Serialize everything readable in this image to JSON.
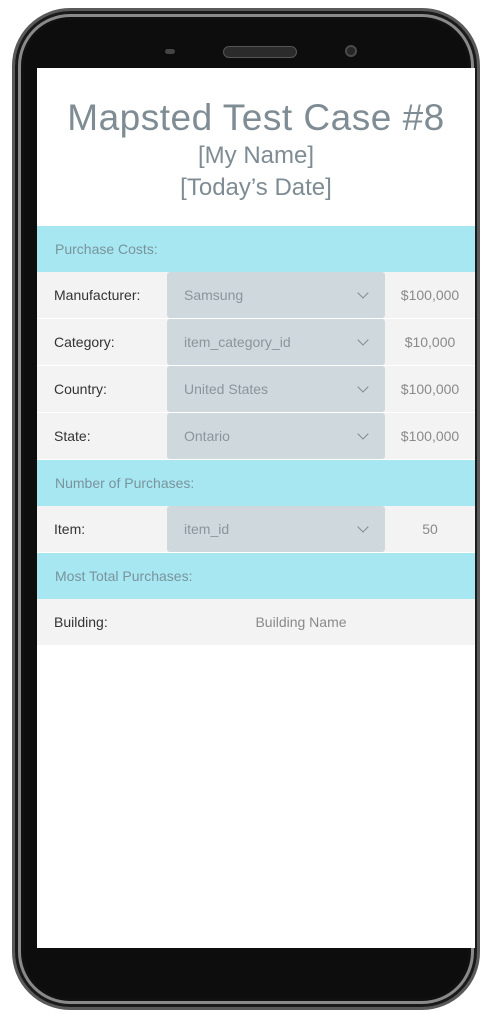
{
  "header": {
    "title": "Mapsted Test Case #8",
    "name": "[My Name]",
    "date": "[Today’s Date]"
  },
  "purchase_costs": {
    "heading": "Purchase Costs:",
    "rows": [
      {
        "label": "Manufacturer:",
        "selected": "Samsung",
        "value": "$100,000"
      },
      {
        "label": "Category:",
        "selected": "item_category_id",
        "value": "$10,000"
      },
      {
        "label": "Country:",
        "selected": "United States",
        "value": "$100,000"
      },
      {
        "label": "State:",
        "selected": "Ontario",
        "value": "$100,000"
      }
    ]
  },
  "number_of_purchases": {
    "heading": "Number of Purchases:",
    "row": {
      "label": "Item:",
      "selected": "item_id",
      "value": "50"
    }
  },
  "most_total_purchases": {
    "heading": "Most Total Purchases:",
    "row": {
      "label": "Building:",
      "value": "Building Name"
    }
  },
  "colors": {
    "section_header": "#a7e7f2",
    "title_text": "#7f8c94",
    "select_bg": "#cfd8dd"
  }
}
